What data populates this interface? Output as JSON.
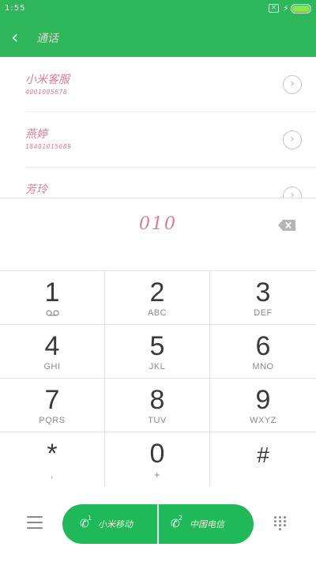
{
  "status_bar": {
    "time": "1:55",
    "sim_icon": "sim-x-icon",
    "charging_icon": "bolt-icon",
    "battery_icon": "battery-icon"
  },
  "header": {
    "title": "通话",
    "back_icon": "chevron-left-icon"
  },
  "contacts": [
    {
      "name": "小米客服",
      "number": "4001005678"
    },
    {
      "name": "燕婷",
      "number": "18401015689"
    },
    {
      "name": "芳玲",
      "number": ""
    }
  ],
  "input": {
    "digits": "010",
    "backspace_icon": "backspace-icon"
  },
  "keypad": [
    {
      "digit": "1",
      "letters": ""
    },
    {
      "digit": "2",
      "letters": "ABC"
    },
    {
      "digit": "3",
      "letters": "DEF"
    },
    {
      "digit": "4",
      "letters": "GHI"
    },
    {
      "digit": "5",
      "letters": "JKL"
    },
    {
      "digit": "6",
      "letters": "MNO"
    },
    {
      "digit": "7",
      "letters": "PQRS"
    },
    {
      "digit": "8",
      "letters": "TUV"
    },
    {
      "digit": "9",
      "letters": "WXYZ"
    },
    {
      "digit": "*",
      "letters": ","
    },
    {
      "digit": "0",
      "letters": "+"
    },
    {
      "digit": "#",
      "letters": ""
    }
  ],
  "bottom": {
    "menu_icon": "menu-icon",
    "sim1_label": "小米移动",
    "sim1_index": "1",
    "sim2_label": "中国电信",
    "sim2_index": "2",
    "grid_icon": "dialpad-grid-icon",
    "accent": "#20b95a"
  },
  "colors": {
    "header": "#2db65a",
    "handwriting": "#e37a94"
  }
}
